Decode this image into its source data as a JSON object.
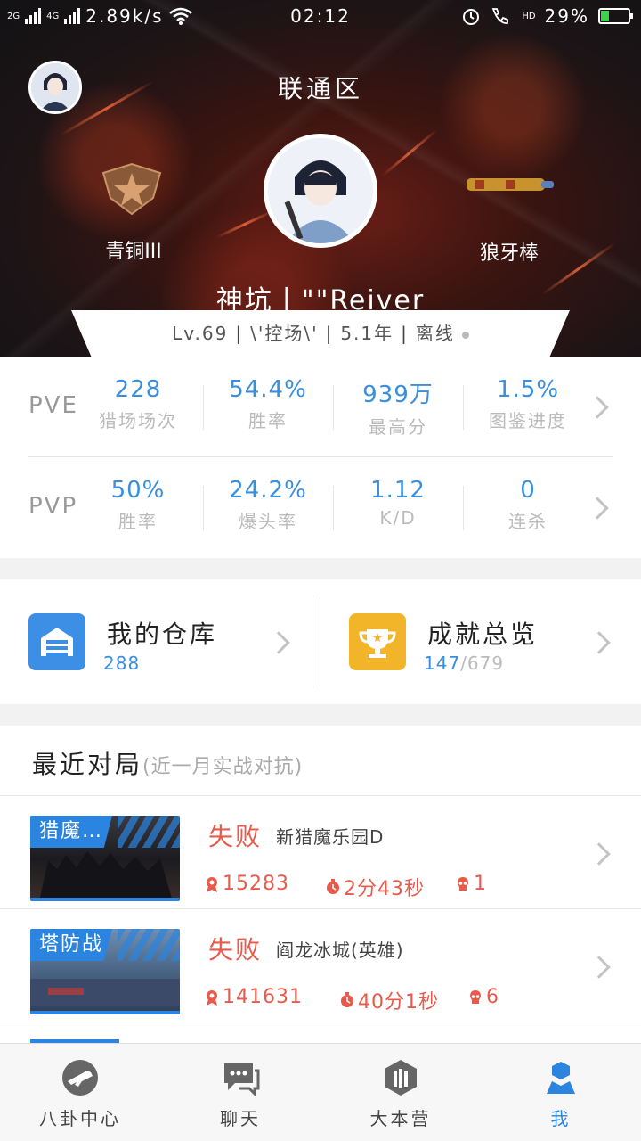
{
  "status_bar": {
    "net_2g": "2G",
    "net_4g": "4G",
    "speed": "2.89k/s",
    "time": "02:12",
    "hd": "HD",
    "battery": "29%",
    "battery_level": 0.29
  },
  "profile": {
    "server": "联通区",
    "rank_label": "青铜III",
    "weapon_label": "狼牙棒",
    "player_name": "神坑丨\"\"Reiver",
    "level": "Lv.69",
    "clan": "\\'控场\\'",
    "years": "5.1年",
    "online_status": "离线"
  },
  "pve": {
    "mode": "PVE",
    "stats": [
      {
        "value": "228",
        "label": "猎场场次"
      },
      {
        "value": "54.4%",
        "label": "胜率"
      },
      {
        "value": "939万",
        "label": "最高分"
      },
      {
        "value": "1.5%",
        "label": "图鉴进度"
      }
    ]
  },
  "pvp": {
    "mode": "PVP",
    "stats": [
      {
        "value": "50%",
        "label": "胜率"
      },
      {
        "value": "24.2%",
        "label": "爆头率"
      },
      {
        "value": "1.12",
        "label": "K/D"
      },
      {
        "value": "0",
        "label": "连杀"
      }
    ]
  },
  "warehouse": {
    "title": "我的仓库",
    "count": "288"
  },
  "achievements": {
    "title": "成就总览",
    "done": "147",
    "total": "/679"
  },
  "recent": {
    "title": "最近对局",
    "subtitle": "(近一月实战对抗)",
    "matches": [
      {
        "tag": "猎魔…",
        "result": "失败",
        "map": "新猎魔乐园D",
        "score": "15283",
        "duration": "2分43秒",
        "kills": "1"
      },
      {
        "tag": "塔防战",
        "result": "失败",
        "map": "阎龙冰城(英雄)",
        "score": "141631",
        "duration": "40分1秒",
        "kills": "6"
      }
    ]
  },
  "tabbar": {
    "tabs": [
      {
        "label": "八卦中心",
        "icon": "gun-icon"
      },
      {
        "label": "聊天",
        "icon": "chat-icon"
      },
      {
        "label": "大本营",
        "icon": "base-icon"
      },
      {
        "label": "我",
        "icon": "profile-icon"
      }
    ],
    "active": "我"
  },
  "colors": {
    "accent": "#3a8fdc",
    "defeat": "#e85a4b",
    "tab_active": "#2a84e0"
  }
}
